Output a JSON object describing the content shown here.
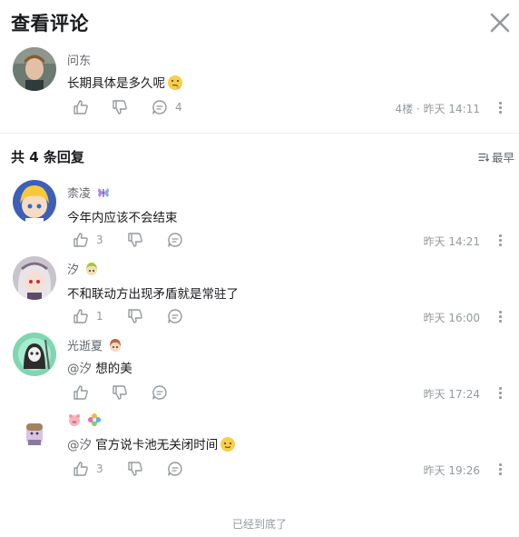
{
  "header": {
    "title": "查看评论",
    "close_icon": "close-icon"
  },
  "main_comment": {
    "username": "问东",
    "content": "长期具体是多久呢",
    "reply_count": "4",
    "floor": "4楼",
    "time": "昨天 14:11"
  },
  "replies_header": {
    "title": "共 4 条回复",
    "sort_label": "最早"
  },
  "replies": [
    {
      "username": "柰凌",
      "content": "今年内应该不会结束",
      "mention": "",
      "like_count": "3",
      "time": "昨天 14:21"
    },
    {
      "username": "汐",
      "content": "不和联动方出现矛盾就是常驻了",
      "mention": "",
      "like_count": "1",
      "time": "昨天 16:00"
    },
    {
      "username": "光逝夏",
      "content": "想的美",
      "mention": "@汐",
      "like_count": "",
      "time": "昨天 17:24"
    },
    {
      "username": "",
      "content": "官方说卡池无关闭时间",
      "mention": "@汐",
      "like_count": "3",
      "time": "昨天 19:26"
    }
  ],
  "footer": {
    "end_text": "已经到底了"
  },
  "colors": {
    "text": "#18191c",
    "secondary": "#61666d",
    "muted": "#9499a0",
    "mention": "#61666d"
  }
}
